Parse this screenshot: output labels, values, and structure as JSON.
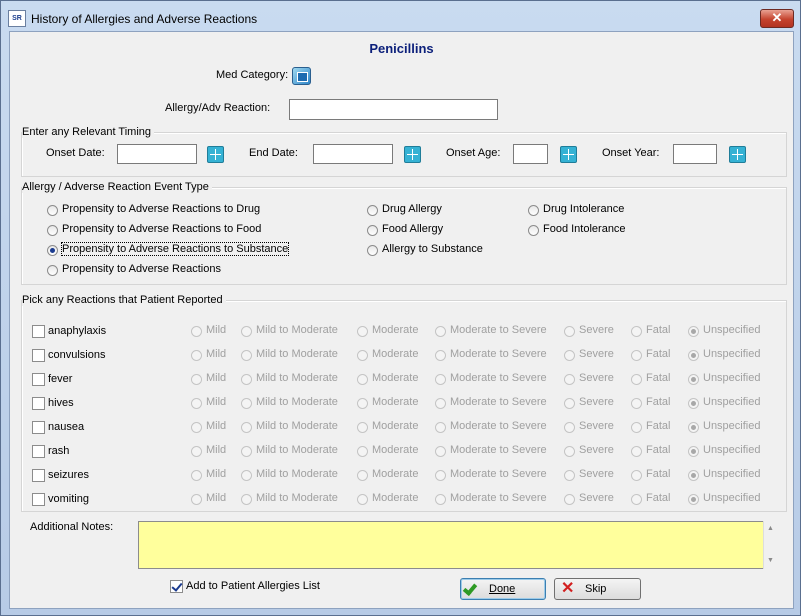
{
  "window": {
    "title": "History of Allergies and Adverse Reactions",
    "app_icon_text": "SR",
    "close_symbol": "✕"
  },
  "heading": "Penicillins",
  "med_category_label": "Med Category:",
  "allergy_reaction_label": "Allergy/Adv Reaction:",
  "allergy_reaction_value": "",
  "timing": {
    "group_label": "Enter any Relevant Timing",
    "onset_date_label": "Onset Date:",
    "end_date_label": "End Date:",
    "onset_age_label": "Onset Age:",
    "onset_year_label": "Onset Year:"
  },
  "event_type": {
    "group_label": "Allergy / Adverse Reaction Event Type",
    "options": [
      "Propensity to Adverse Reactions to Drug",
      "Propensity to Adverse Reactions to Food",
      "Propensity to Adverse Reactions to Substance",
      "Propensity to Adverse Reactions",
      "Drug Allergy",
      "Food Allergy",
      "Allergy to Substance",
      "Drug Intolerance",
      "Food Intolerance"
    ],
    "selected": "Propensity to Adverse Reactions to Substance"
  },
  "reactions": {
    "group_label": "Pick any Reactions that Patient Reported",
    "severities": [
      "Mild",
      "Mild to Moderate",
      "Moderate",
      "Moderate to Severe",
      "Severe",
      "Fatal",
      "Unspecified"
    ],
    "default_severity": "Unspecified",
    "items": [
      "anaphylaxis",
      "convulsions",
      "fever",
      "hives",
      "nausea",
      "rash",
      "seizures",
      "vomiting"
    ]
  },
  "notes_label": "Additional Notes:",
  "notes_value": "",
  "add_to_list": {
    "label": "Add to Patient Allergies List",
    "checked": true
  },
  "buttons": {
    "done": "Done",
    "skip": "Skip"
  },
  "colors": {
    "heading": "#0b1f7a",
    "notes_bg": "#ffff9c",
    "picker": "#35b2d4"
  }
}
